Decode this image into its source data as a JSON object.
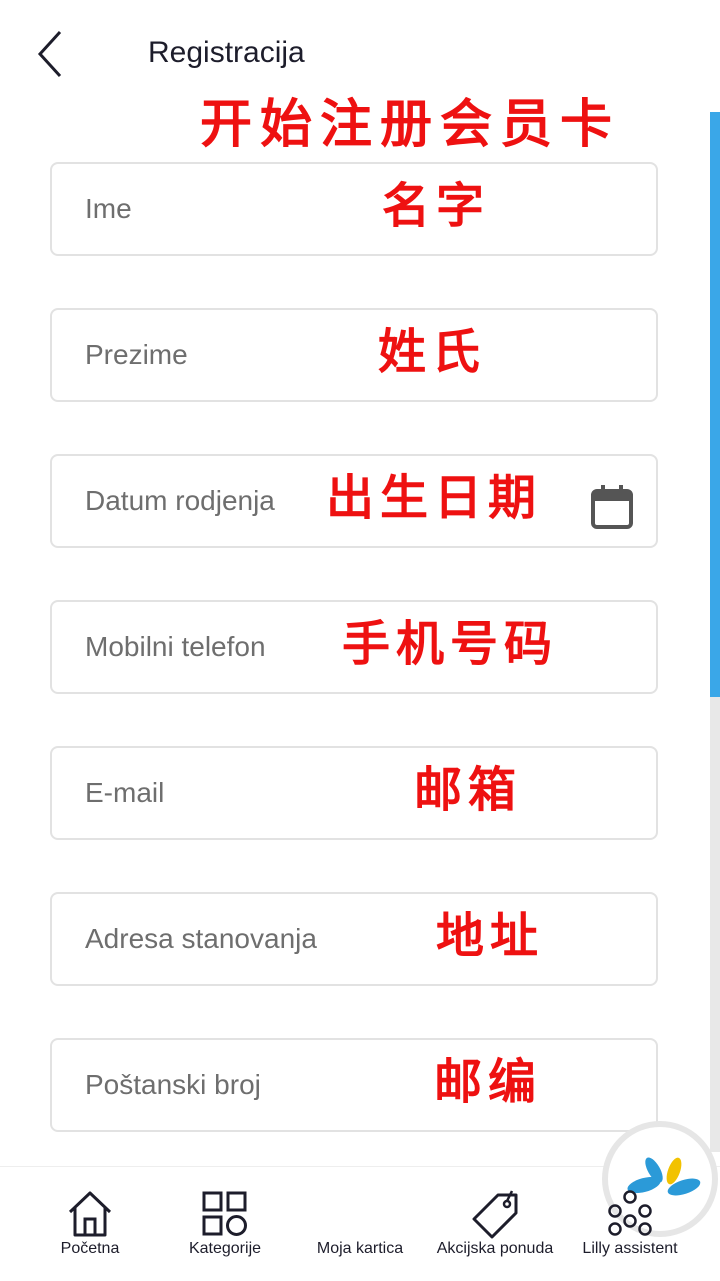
{
  "header": {
    "title": "Registracija",
    "annotation": "开始注册会员卡"
  },
  "form": {
    "fields": [
      {
        "placeholder": "Ime",
        "annotation": "名字"
      },
      {
        "placeholder": "Prezime",
        "annotation": "姓氏"
      },
      {
        "placeholder": "Datum rodjenja",
        "annotation": "出生日期"
      },
      {
        "placeholder": "Mobilni telefon",
        "annotation": "手机号码"
      },
      {
        "placeholder": "E-mail",
        "annotation": "邮箱"
      },
      {
        "placeholder": "Adresa stanovanja",
        "annotation": "地址"
      },
      {
        "placeholder": "Poštanski broj",
        "annotation": "邮编"
      }
    ]
  },
  "bottom_nav": {
    "items": [
      {
        "label": "Početna",
        "icon": "home-icon"
      },
      {
        "label": "Kategorije",
        "icon": "categories-icon"
      },
      {
        "label": "Moja kartica",
        "icon": "card-logo-icon"
      },
      {
        "label": "Akcijska ponuda",
        "icon": "price-tag-icon"
      },
      {
        "label": "Lilly assistent",
        "icon": "assistant-icon"
      }
    ]
  },
  "colors": {
    "accent": "#3aa7e8",
    "annotation": "#ee1111",
    "logo_blue": "#2b9ad8",
    "logo_yellow": "#f2c200"
  }
}
